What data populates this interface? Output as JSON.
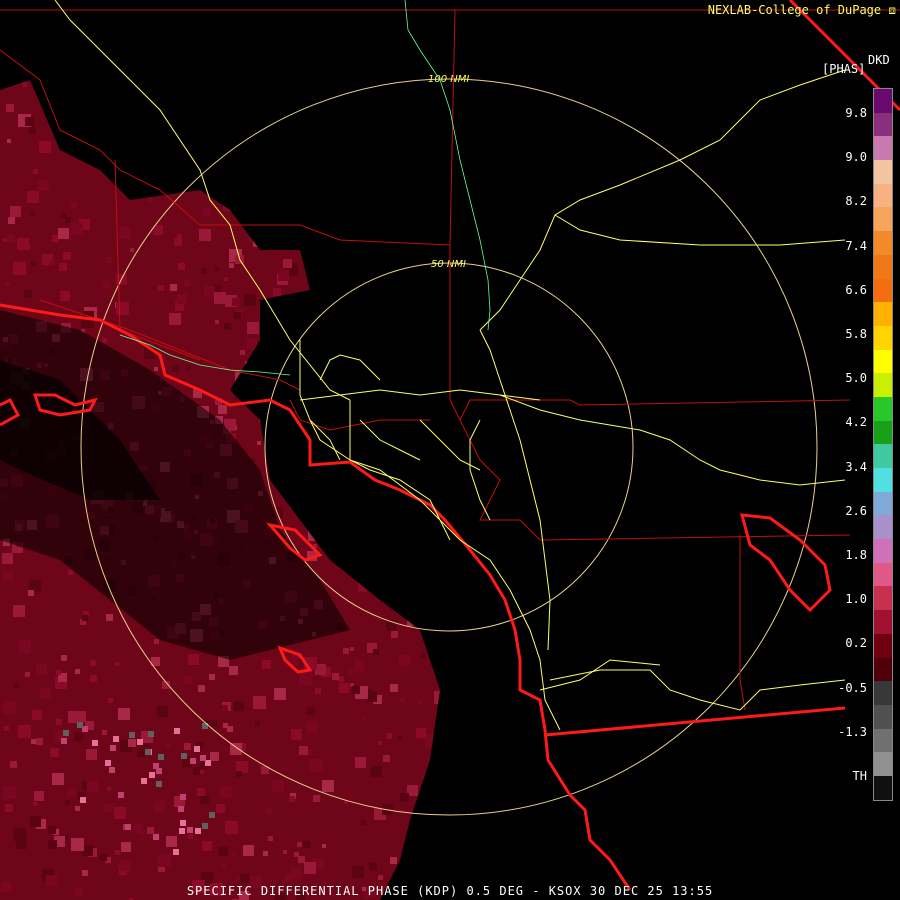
{
  "credit": "NEXLAB-College of DuPage",
  "product_code": "DKD",
  "unit": "[PHAS]",
  "footer": "SPECIFIC DIFFERENTIAL PHASE (KDP) 0.5 DEG - KSOX 30 DEC 25 13:55",
  "range_rings": [
    "100 NMI",
    "50 NMI"
  ],
  "legend": {
    "ticks": [
      "9.8",
      "9.0",
      "8.2",
      "7.4",
      "6.6",
      "5.8",
      "5.0",
      "4.2",
      "3.4",
      "2.6",
      "1.8",
      "1.0",
      "0.2",
      "-0.5",
      "-1.3",
      "TH"
    ],
    "colors": [
      "#6a0a6e",
      "#8a2f7c",
      "#c87ab0",
      "#f2c4a2",
      "#f6b282",
      "#f7a45c",
      "#f28a2a",
      "#f07818",
      "#f46d10",
      "#ffb000",
      "#ffd400",
      "#ffff00",
      "#c8f000",
      "#28c828",
      "#18a018",
      "#40c8a0",
      "#50e0e0",
      "#80a8d8",
      "#a890c8",
      "#d070b8",
      "#e05888",
      "#c83050",
      "#a01030",
      "#700010",
      "#500008",
      "#383838",
      "#505050",
      "#707070",
      "#909090",
      "#101010"
    ]
  },
  "colors": {
    "reflectivity_base": "#6e0518",
    "reflectivity_light": "#8a0a28",
    "roads": "#ffff66",
    "boundaries": "#c01010",
    "coast": "#ff1a1a",
    "rings": "#e8d090",
    "river": "#66ff99"
  }
}
